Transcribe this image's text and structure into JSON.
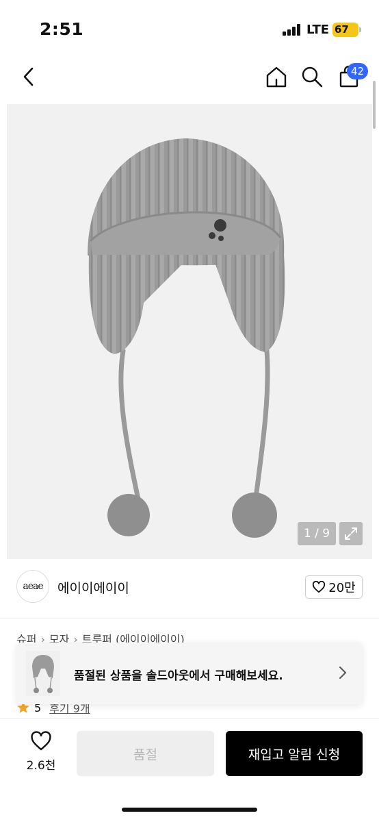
{
  "status_bar": {
    "time": "2:51",
    "network": "LTE",
    "battery": "67",
    "battery_color": "#f5c518"
  },
  "nav": {
    "back_icon": "chevron-left-icon",
    "home_icon": "home-icon",
    "search_icon": "search-icon",
    "cart_icon": "shopping-bag-icon",
    "cart_count": "42",
    "badge_color": "#3366ff"
  },
  "gallery": {
    "counter": "1 / 9",
    "expand_icon": "expand-icon"
  },
  "brand": {
    "logo_text": "aeae",
    "name": "에이이에이이",
    "likes": "20만"
  },
  "breadcrumb": {
    "items": [
      "슈퍼",
      "모자",
      "트루퍼 (에이이에이이)"
    ]
  },
  "rating": {
    "score": "5",
    "reviews": "후기 9개",
    "star_color": "#f5a623"
  },
  "soldout_banner": {
    "message": "품절된 상품을 솔드아웃에서 구매해보세요.",
    "chevron_icon": "chevron-right-icon"
  },
  "bottom_bar": {
    "wish_count": "2.6천",
    "soldout_label": "품절",
    "restock_label": "재입고 알림 신청"
  }
}
